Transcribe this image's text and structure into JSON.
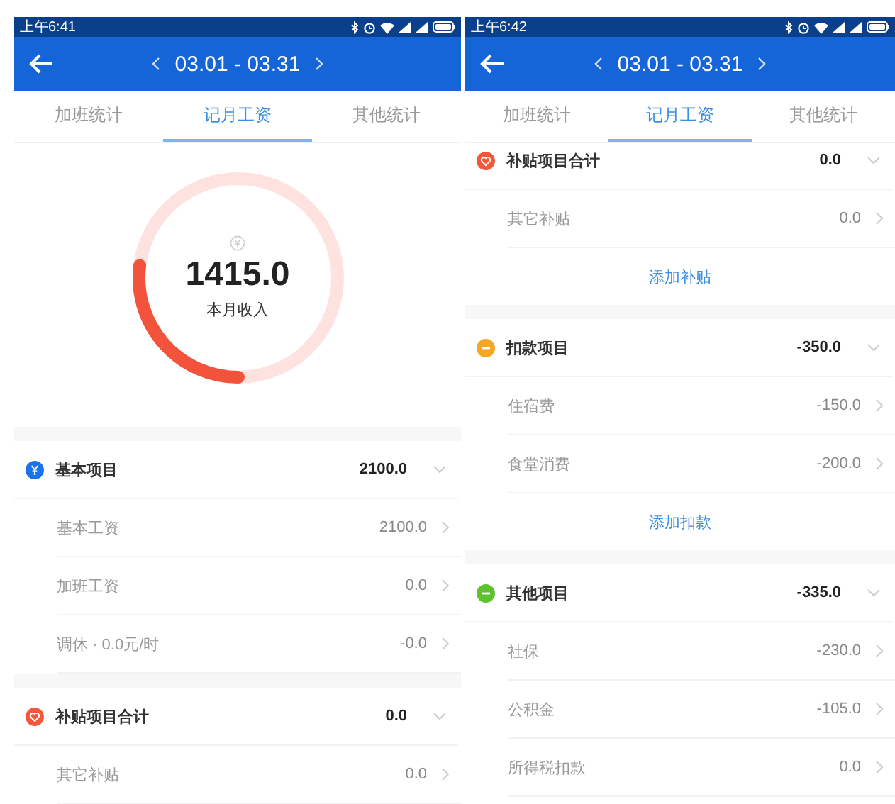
{
  "screens": [
    {
      "status_time": "上午6:41",
      "date_range": "03.01 - 03.31",
      "tabs": [
        {
          "label": "加班统计",
          "selected": false
        },
        {
          "label": "记月工资",
          "selected": true
        },
        {
          "label": "其他统计",
          "selected": false
        }
      ],
      "summary": {
        "amount": "1415.0",
        "label": "本月收入",
        "level": 0.27
      },
      "sections": [
        {
          "title": "基本项目",
          "total": "2100.0",
          "kind": "yen",
          "color": "#1a73e8",
          "items": [
            {
              "label": "基本工资",
              "value": "2100.0"
            },
            {
              "label": "加班工资",
              "value": "0.0"
            },
            {
              "label": "调休 · 0.0元/时",
              "value": "-0.0"
            }
          ]
        },
        {
          "title": "补贴项目合计",
          "total": "0.0",
          "kind": "heart",
          "color": "#f4583a",
          "items": [
            {
              "label": "其它补贴",
              "value": "0.0"
            }
          ]
        }
      ]
    },
    {
      "status_time": "上午6:42",
      "date_range": "03.01 - 03.31",
      "tabs": [
        {
          "label": "加班统计",
          "selected": false
        },
        {
          "label": "记月工资",
          "selected": true
        },
        {
          "label": "其他统计",
          "selected": false
        }
      ],
      "sections": [
        {
          "title": "补贴项目合计",
          "total": "0.0",
          "kind": "heart",
          "color": "#f4583a",
          "items": [
            {
              "label": "其它补贴",
              "value": "0.0"
            }
          ],
          "add_link": "添加补贴"
        },
        {
          "title": "扣款项目",
          "total": "-350.0",
          "kind": "minus",
          "color": "#f5a623",
          "items": [
            {
              "label": "住宿费",
              "value": "-150.0"
            },
            {
              "label": "食堂消费",
              "value": "-200.0"
            }
          ],
          "add_link": "添加扣款"
        },
        {
          "title": "其他项目",
          "total": "-335.0",
          "kind": "minus",
          "color": "#5ec22e",
          "items": [
            {
              "label": "社保",
              "value": "-230.0"
            },
            {
              "label": "公积金",
              "value": "-105.0"
            },
            {
              "label": "所得税扣款",
              "value": "0.0"
            }
          ]
        }
      ]
    }
  ]
}
